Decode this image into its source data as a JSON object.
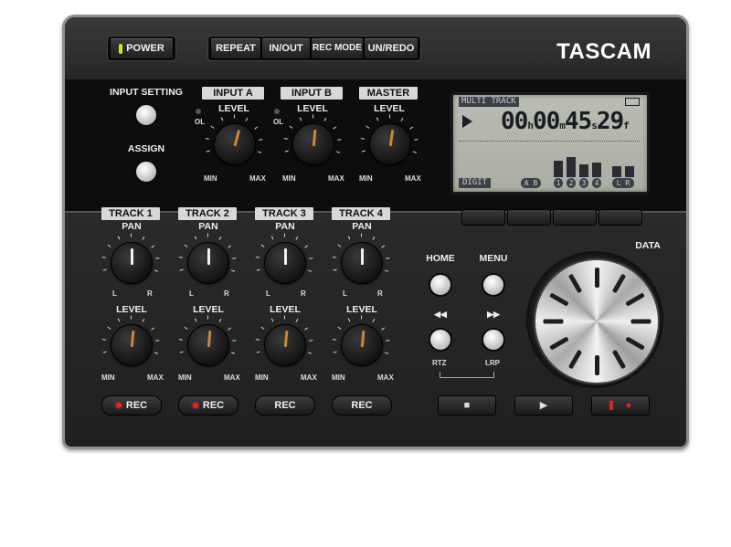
{
  "brand": "TASCAM",
  "top_buttons": {
    "power": "POWER",
    "repeat": "REPEAT",
    "in_out": "IN/OUT",
    "rec_mode": "REC MODE",
    "un_redo": "UN/REDO"
  },
  "input_section": {
    "input_setting": "INPUT SETTING",
    "assign": "ASSIGN",
    "channels": [
      {
        "tag": "INPUT A",
        "level": "LEVEL",
        "ol": "OL",
        "min": "MIN",
        "max": "MAX"
      },
      {
        "tag": "INPUT B",
        "level": "LEVEL",
        "ol": "OL",
        "min": "MIN",
        "max": "MAX"
      },
      {
        "tag": "MASTER",
        "level": "LEVEL",
        "min": "MIN",
        "max": "MAX"
      }
    ]
  },
  "display": {
    "mode": "MULTI TRACK",
    "time_h": "00",
    "unit_h": "h",
    "time_m": "00",
    "unit_m": "m",
    "time_s": "45",
    "unit_s": "s",
    "time_f": "29",
    "unit_f": "f",
    "bottom_label": "DIGIT",
    "ab_label": "A B",
    "track_labels": [
      "1",
      "2",
      "3",
      "4"
    ],
    "lr_label": "L R"
  },
  "tracks": [
    {
      "tag": "TRACK 1",
      "pan": "PAN",
      "l": "L",
      "r": "R",
      "level": "LEVEL",
      "min": "MIN",
      "max": "MAX",
      "rec": "REC",
      "rec_led": true
    },
    {
      "tag": "TRACK 2",
      "pan": "PAN",
      "l": "L",
      "r": "R",
      "level": "LEVEL",
      "min": "MIN",
      "max": "MAX",
      "rec": "REC",
      "rec_led": true
    },
    {
      "tag": "TRACK 3",
      "pan": "PAN",
      "l": "L",
      "r": "R",
      "level": "LEVEL",
      "min": "MIN",
      "max": "MAX",
      "rec": "REC",
      "rec_led": false
    },
    {
      "tag": "TRACK 4",
      "pan": "PAN",
      "l": "L",
      "r": "R",
      "level": "LEVEL",
      "min": "MIN",
      "max": "MAX",
      "rec": "REC",
      "rec_led": false
    }
  ],
  "nav": {
    "home": "HOME",
    "menu": "MENU",
    "rtz": "RTZ",
    "lrp": "LRP",
    "rewind_glyph": "◀◀",
    "forward_glyph": "▶▶",
    "data": "DATA",
    "stop_glyph": "■",
    "play_glyph": "▶",
    "rec_glyph": "●"
  },
  "colors": {
    "power_led": "#c8e832",
    "rec_led": "#e0261c",
    "knob_indicator": "#c9863a",
    "pan_indicator": "#f2f2f2"
  }
}
